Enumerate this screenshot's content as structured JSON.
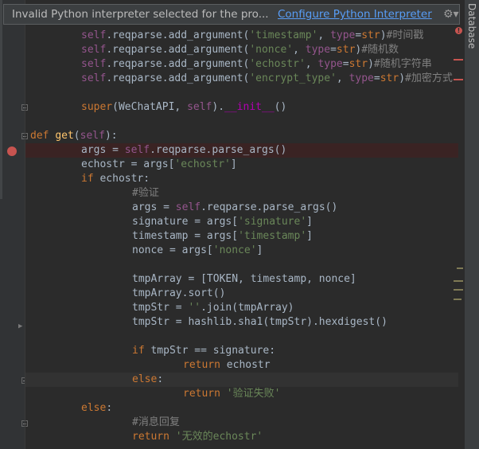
{
  "banner": {
    "message": "Invalid Python interpreter selected for the pro...",
    "link": "Configure Python Interpreter",
    "gear_icon": "gear-icon"
  },
  "sidebar": {
    "tab_label": "Database"
  },
  "code_lines": [
    [
      [
        "self",
        "self"
      ],
      [
        "plain",
        ".reqparse.add_argument("
      ],
      [
        "str",
        "'timestamp'"
      ],
      [
        "plain",
        ", "
      ],
      [
        "self",
        "type"
      ],
      [
        "plain",
        "="
      ],
      [
        "kw",
        "str"
      ],
      [
        "plain",
        ")"
      ],
      [
        "cmt",
        "#时间戳"
      ]
    ],
    [
      [
        "self",
        "self"
      ],
      [
        "plain",
        ".reqparse.add_argument("
      ],
      [
        "str",
        "'nonce'"
      ],
      [
        "plain",
        ", "
      ],
      [
        "self",
        "type"
      ],
      [
        "plain",
        "="
      ],
      [
        "kw",
        "str"
      ],
      [
        "plain",
        ")"
      ],
      [
        "cmt",
        "#随机数"
      ]
    ],
    [
      [
        "self",
        "self"
      ],
      [
        "plain",
        ".reqparse.add_argument("
      ],
      [
        "str",
        "'echostr'"
      ],
      [
        "plain",
        ", "
      ],
      [
        "self",
        "type"
      ],
      [
        "plain",
        "="
      ],
      [
        "kw",
        "str"
      ],
      [
        "plain",
        ")"
      ],
      [
        "cmt",
        "#随机字符串"
      ]
    ],
    [
      [
        "self",
        "self"
      ],
      [
        "plain",
        ".reqparse.add_argument("
      ],
      [
        "str",
        "'encrypt_type'"
      ],
      [
        "plain",
        ", "
      ],
      [
        "self",
        "type"
      ],
      [
        "plain",
        "="
      ],
      [
        "kw",
        "str"
      ],
      [
        "plain",
        ")"
      ],
      [
        "cmt",
        "#加密方式"
      ]
    ],
    [],
    [
      [
        "kw",
        "super"
      ],
      [
        "plain",
        "(WeChatAPI, "
      ],
      [
        "self",
        "self"
      ],
      [
        "plain",
        ")."
      ],
      [
        "dunder",
        "__init__"
      ],
      [
        "plain",
        "()"
      ]
    ],
    [],
    [
      [
        "kw",
        "def "
      ],
      [
        "fn",
        "get"
      ],
      [
        "plain",
        "("
      ],
      [
        "self",
        "self"
      ],
      [
        "plain",
        "):"
      ]
    ],
    [
      [
        "plain",
        "args = "
      ],
      [
        "self",
        "self"
      ],
      [
        "plain",
        ".reqparse.parse_args()"
      ]
    ],
    [
      [
        "plain",
        "echostr = args["
      ],
      [
        "str",
        "'echostr'"
      ],
      [
        "plain",
        "]"
      ]
    ],
    [
      [
        "kw",
        "if "
      ],
      [
        "plain",
        "echostr:"
      ]
    ],
    [
      [
        "cmt",
        "#验证"
      ]
    ],
    [
      [
        "plain",
        "args = "
      ],
      [
        "self",
        "self"
      ],
      [
        "plain",
        ".reqparse.parse_args()"
      ]
    ],
    [
      [
        "plain",
        "signature = args["
      ],
      [
        "str",
        "'signature'"
      ],
      [
        "plain",
        "]"
      ]
    ],
    [
      [
        "plain",
        "timestamp = args["
      ],
      [
        "str",
        "'timestamp'"
      ],
      [
        "plain",
        "]"
      ]
    ],
    [
      [
        "plain",
        "nonce = args["
      ],
      [
        "str",
        "'nonce'"
      ],
      [
        "plain",
        "]"
      ]
    ],
    [],
    [
      [
        "plain",
        "tmpArray = [TOKEN, timestamp, nonce]"
      ]
    ],
    [
      [
        "plain",
        "tmpArray.sort()"
      ]
    ],
    [
      [
        "plain",
        "tmpStr = "
      ],
      [
        "str",
        "''"
      ],
      [
        "plain",
        ".join(tmpArray)"
      ]
    ],
    [
      [
        "plain",
        "tmpStr = hashlib.sha1(tmpStr).hexdigest()"
      ]
    ],
    [],
    [
      [
        "kw",
        "if "
      ],
      [
        "plain",
        "tmpStr == signature:"
      ]
    ],
    [
      [
        "kw",
        "return "
      ],
      [
        "plain",
        "echostr"
      ]
    ],
    [
      [
        "kw",
        "else"
      ],
      [
        "plain",
        ":"
      ]
    ],
    [
      [
        "kw",
        "return "
      ],
      [
        "str",
        "'验证失败'"
      ]
    ],
    [
      [
        "kw",
        "else"
      ],
      [
        "plain",
        ":"
      ]
    ],
    [
      [
        "cmt",
        "#消息回复"
      ]
    ],
    [
      [
        "kw",
        "return "
      ],
      [
        "str",
        "'无效的echostr'"
      ]
    ]
  ]
}
